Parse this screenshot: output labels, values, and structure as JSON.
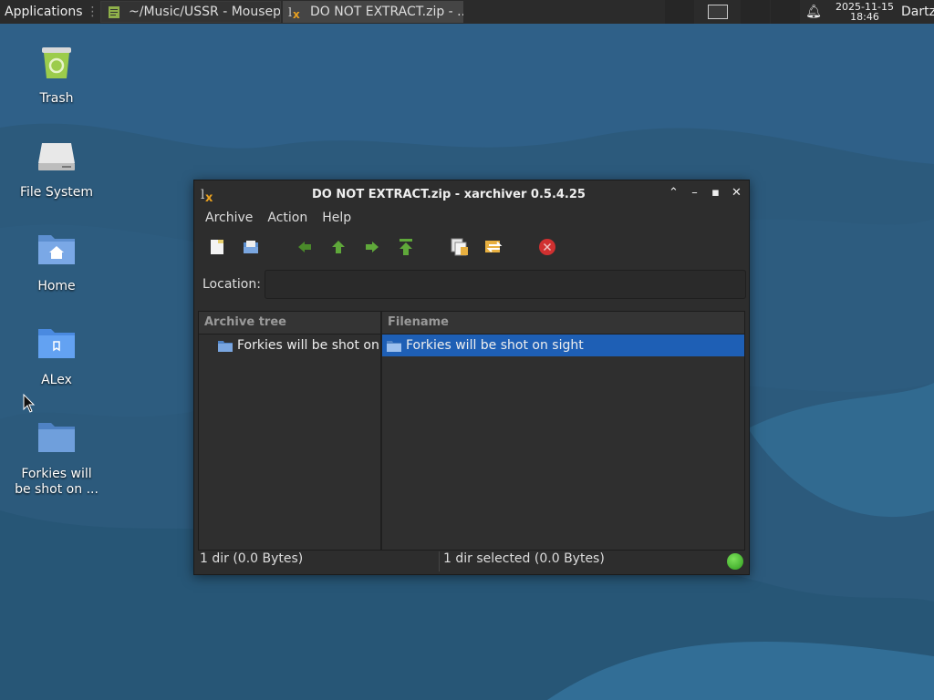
{
  "panel": {
    "applications_label": "Applications",
    "tasks": [
      {
        "label": "~/Music/USSR - Mousep..."
      },
      {
        "label": "DO NOT EXTRACT.zip - ..."
      }
    ],
    "clock_date": "2025-11-15",
    "clock_time": "18:46",
    "user": "Dartz"
  },
  "desktop": {
    "icons": [
      {
        "label": "Trash"
      },
      {
        "label": "File System"
      },
      {
        "label": "Home"
      },
      {
        "label": "ALex"
      },
      {
        "label": "Forkies will be shot on ..."
      }
    ]
  },
  "window": {
    "title": "DO NOT EXTRACT.zip - xarchiver 0.5.4.25",
    "menu": [
      "Archive",
      "Action",
      "Help"
    ],
    "location_label": "Location:",
    "location_value": "",
    "tree_header": "Archive tree",
    "files_header": "Filename",
    "tree_items": [
      "Forkies will be shot on sight"
    ],
    "file_items": [
      "Forkies will be shot on sight"
    ],
    "status_left": "1 dir  (0.0 Bytes)",
    "status_right": "1 dir selected (0.0 Bytes)"
  },
  "colors": {
    "selection": "#1e5fb5",
    "status_led": "#3fbf2a",
    "panel_bg": "#2b2b2b"
  }
}
